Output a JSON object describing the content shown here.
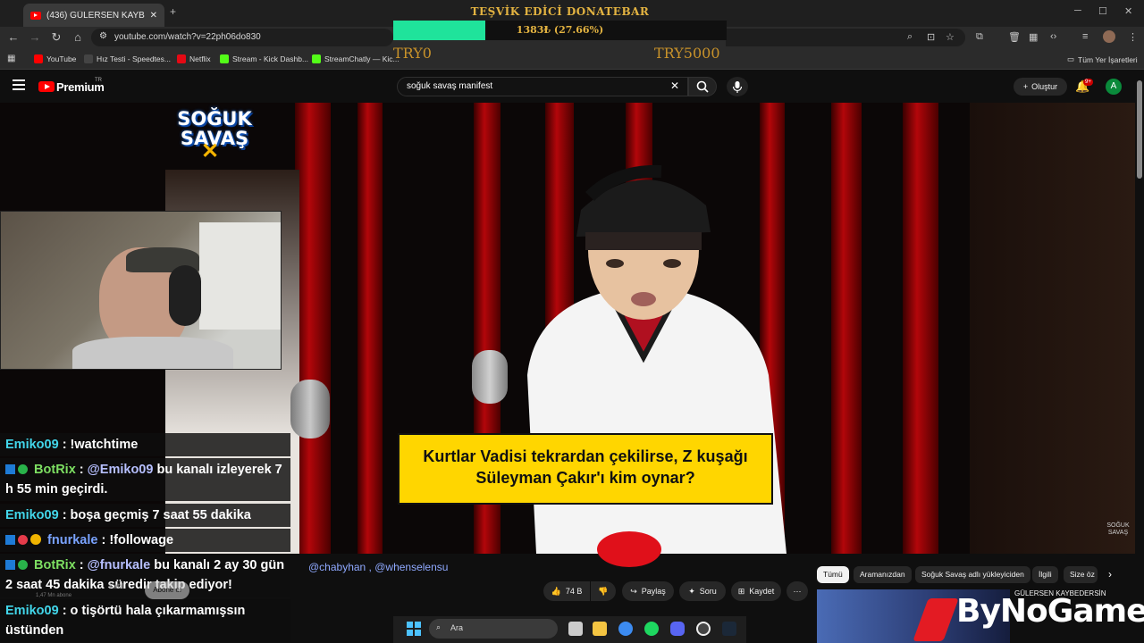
{
  "browser": {
    "tab_title": "(436) GÜLERSEN KAYBEDERSİN",
    "new_tab": "+",
    "url": "youtube.com/watch?v=22ph06do830",
    "bookmarks": [
      {
        "label": "YouTube",
        "color": "#ff0000"
      },
      {
        "label": "Hız Testi - Speedtes...",
        "color": "#141526"
      },
      {
        "label": "Netflix",
        "color": "#e50914"
      },
      {
        "label": "Stream - Kick Dashb...",
        "color": "#53fc18"
      },
      {
        "label": "StreamChatly — Kic...",
        "color": "#53fc18"
      }
    ],
    "all_bookmarks": "Tüm Yer İşaretleri"
  },
  "donation": {
    "title": "TEŞVİK EDİCİ DONATEBAR",
    "amount": "1383₺ (27.66%)",
    "progress": 0.2766,
    "min": "TRY0",
    "max": "TRY5000",
    "fill_color": "#1fe39b"
  },
  "youtube": {
    "brand": "Premium",
    "country": "TR",
    "search_query": "soğuk savaş manifest",
    "create_label": "Oluştur",
    "notif_badge": "9+",
    "avatar_letter": "A"
  },
  "video": {
    "show_logo_line1": "SOĞUK",
    "show_logo_line2": "SAVAŞ",
    "caption": "Kurtlar Vadisi tekrardan çekilirse, Z kuşağı Süleyman Çakır'ı kim oynar?",
    "watermark": "SOĞUK SAVAŞ"
  },
  "chat": [
    {
      "user": "Emiko09",
      "text": ": !watchtime",
      "badges": []
    },
    {
      "user": "BotRix",
      "text": "bu kanalı izleyerek 7 h 55 min geçirdi.",
      "mention": "@Emiko09",
      "badges": [
        "square",
        "check"
      ]
    },
    {
      "user": "Emiko09",
      "text": ": boşa geçmiş 7 saat 55 dakika",
      "badges": []
    },
    {
      "user": "fnurkale",
      "text": ": !followage",
      "badges": [
        "square",
        "heart",
        "gold"
      ]
    },
    {
      "user": "BotRix",
      "text": "bu kanalı 2 ay 30 gün 2 saat 45 dakika süredir takip ediyor!",
      "mention": "@fnurkale",
      "badges": [
        "square",
        "check"
      ]
    },
    {
      "user": "Emiko09",
      "text": ": o tişörtü hala çıkarmamışsın üstünden",
      "badges": []
    }
  ],
  "below_video": {
    "mentions": "@chabyhan , @whenselensu",
    "subs": "1,47 Mn abone",
    "join": "Katıl",
    "subscribe": "Abone ol",
    "likes": "74 B",
    "share": "Paylaş",
    "ask": "Soru",
    "save": "Kaydet",
    "more": "⋯",
    "chips": [
      "Tümü",
      "Aramanızdan",
      "Soğuk Savaş adlı yükleyiciden",
      "İlgili",
      "Size öz"
    ],
    "related_title": "GÜLERSEN KAYBEDERSİN"
  },
  "taskbar": {
    "search_placeholder": "Ara"
  },
  "overlay_brand": "ByNoGame"
}
